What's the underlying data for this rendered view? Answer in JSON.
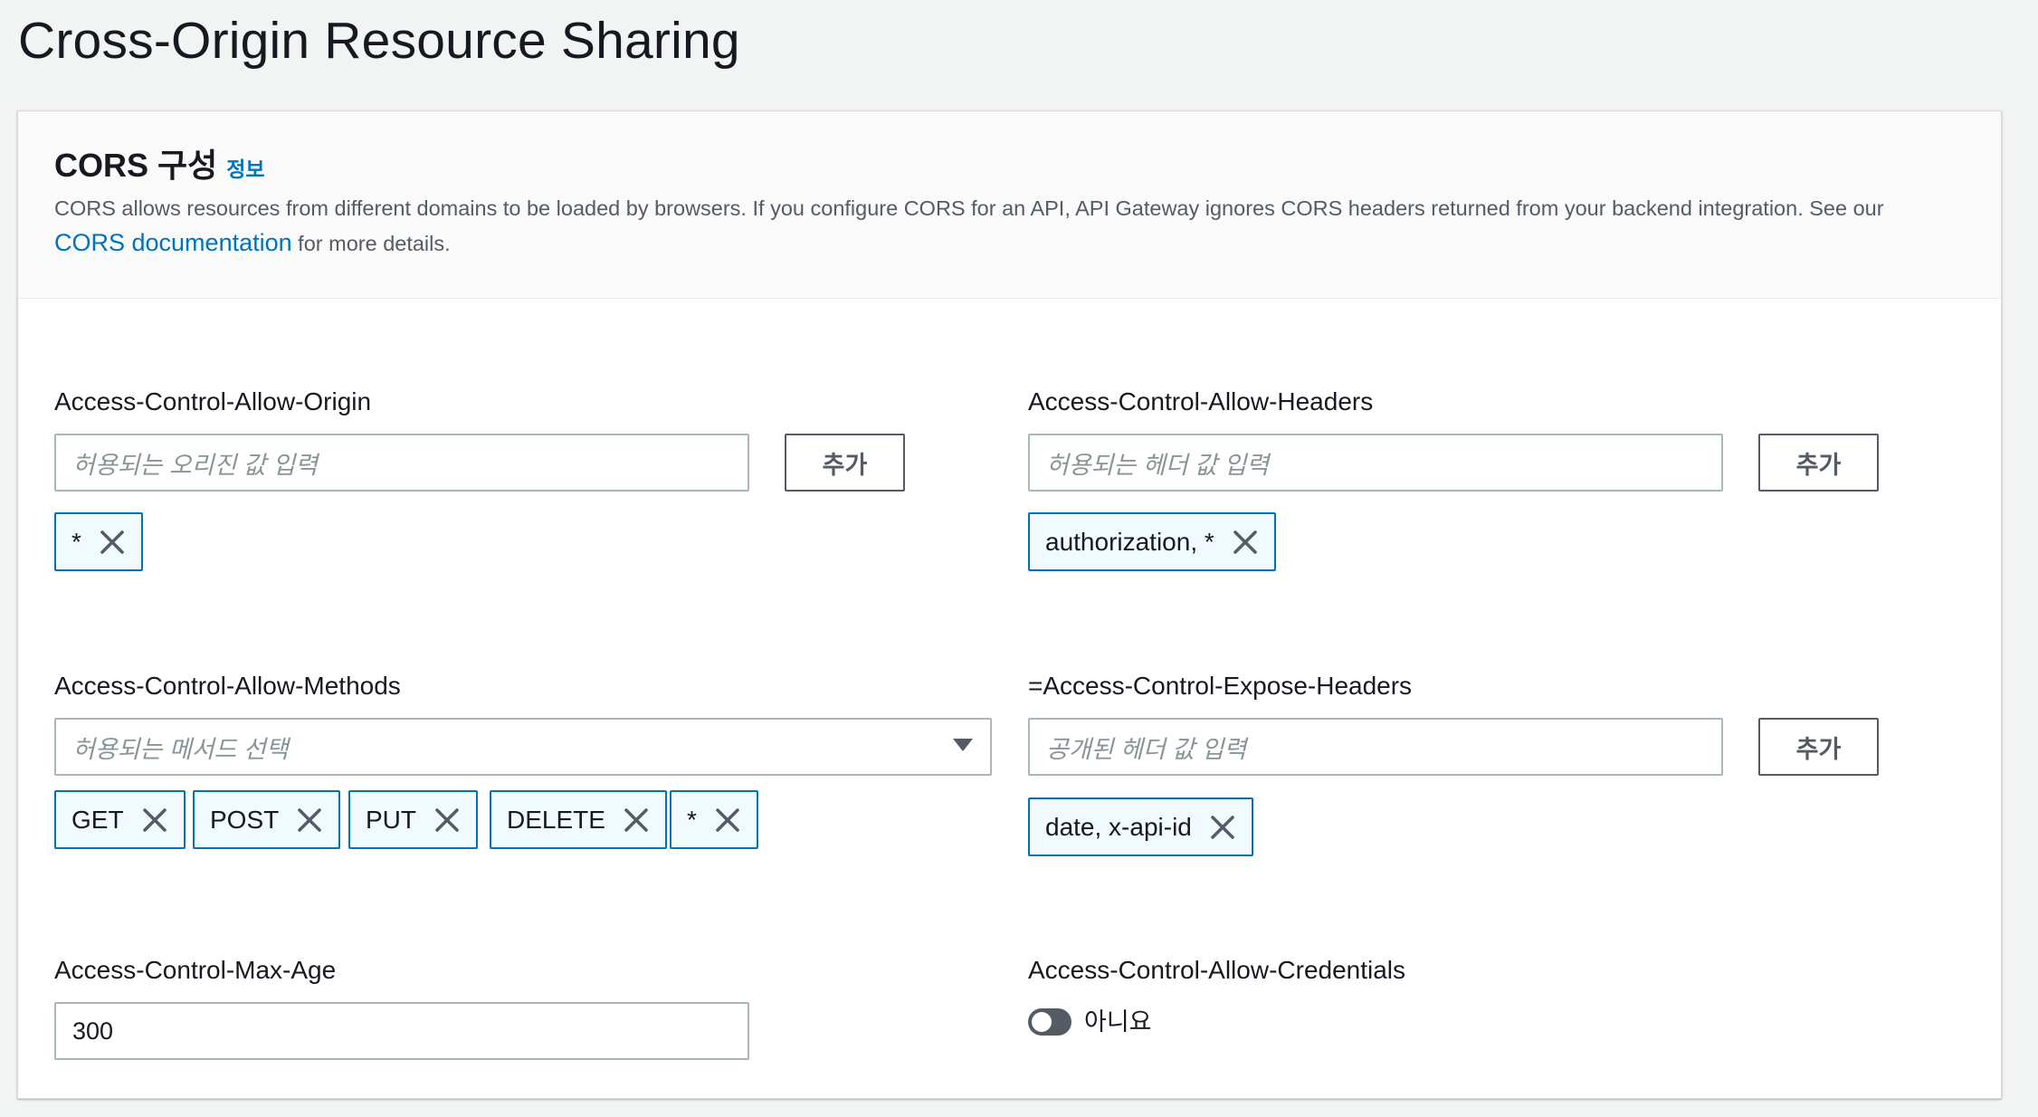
{
  "page": {
    "title": "Cross-Origin Resource Sharing"
  },
  "panel": {
    "title": "CORS 구성",
    "info_link": "정보",
    "description": "CORS allows resources from different domains to be loaded by browsers. If you configure CORS for an API, API Gateway ignores CORS headers returned from your backend integration. See our",
    "doc_link": "CORS documentation",
    "description_suffix": "for more details."
  },
  "allow_origin": {
    "label": "Access-Control-Allow-Origin",
    "placeholder": "허용되는 오리진 값 입력",
    "add_label": "추가",
    "tokens": [
      "*"
    ]
  },
  "allow_headers": {
    "label": "Access-Control-Allow-Headers",
    "placeholder": "허용되는 헤더 값 입력",
    "add_label": "추가",
    "tokens": [
      "authorization, *"
    ]
  },
  "allow_methods": {
    "label": "Access-Control-Allow-Methods",
    "placeholder": "허용되는 메서드 선택",
    "tokens": [
      "GET",
      "POST",
      "PUT",
      "DELETE",
      "*"
    ]
  },
  "expose_headers": {
    "label": "=Access-Control-Expose-Headers",
    "placeholder": "공개된 헤더 값 입력",
    "add_label": "추가",
    "tokens": [
      "date, x-api-id"
    ]
  },
  "max_age": {
    "label": "Access-Control-Max-Age",
    "value": "300"
  },
  "allow_credentials": {
    "label": "Access-Control-Allow-Credentials",
    "toggle_label": "아니요",
    "enabled": false
  },
  "colors": {
    "link": "#0073bb",
    "token_border": "#0073bb",
    "token_bg": "#f1faff"
  }
}
